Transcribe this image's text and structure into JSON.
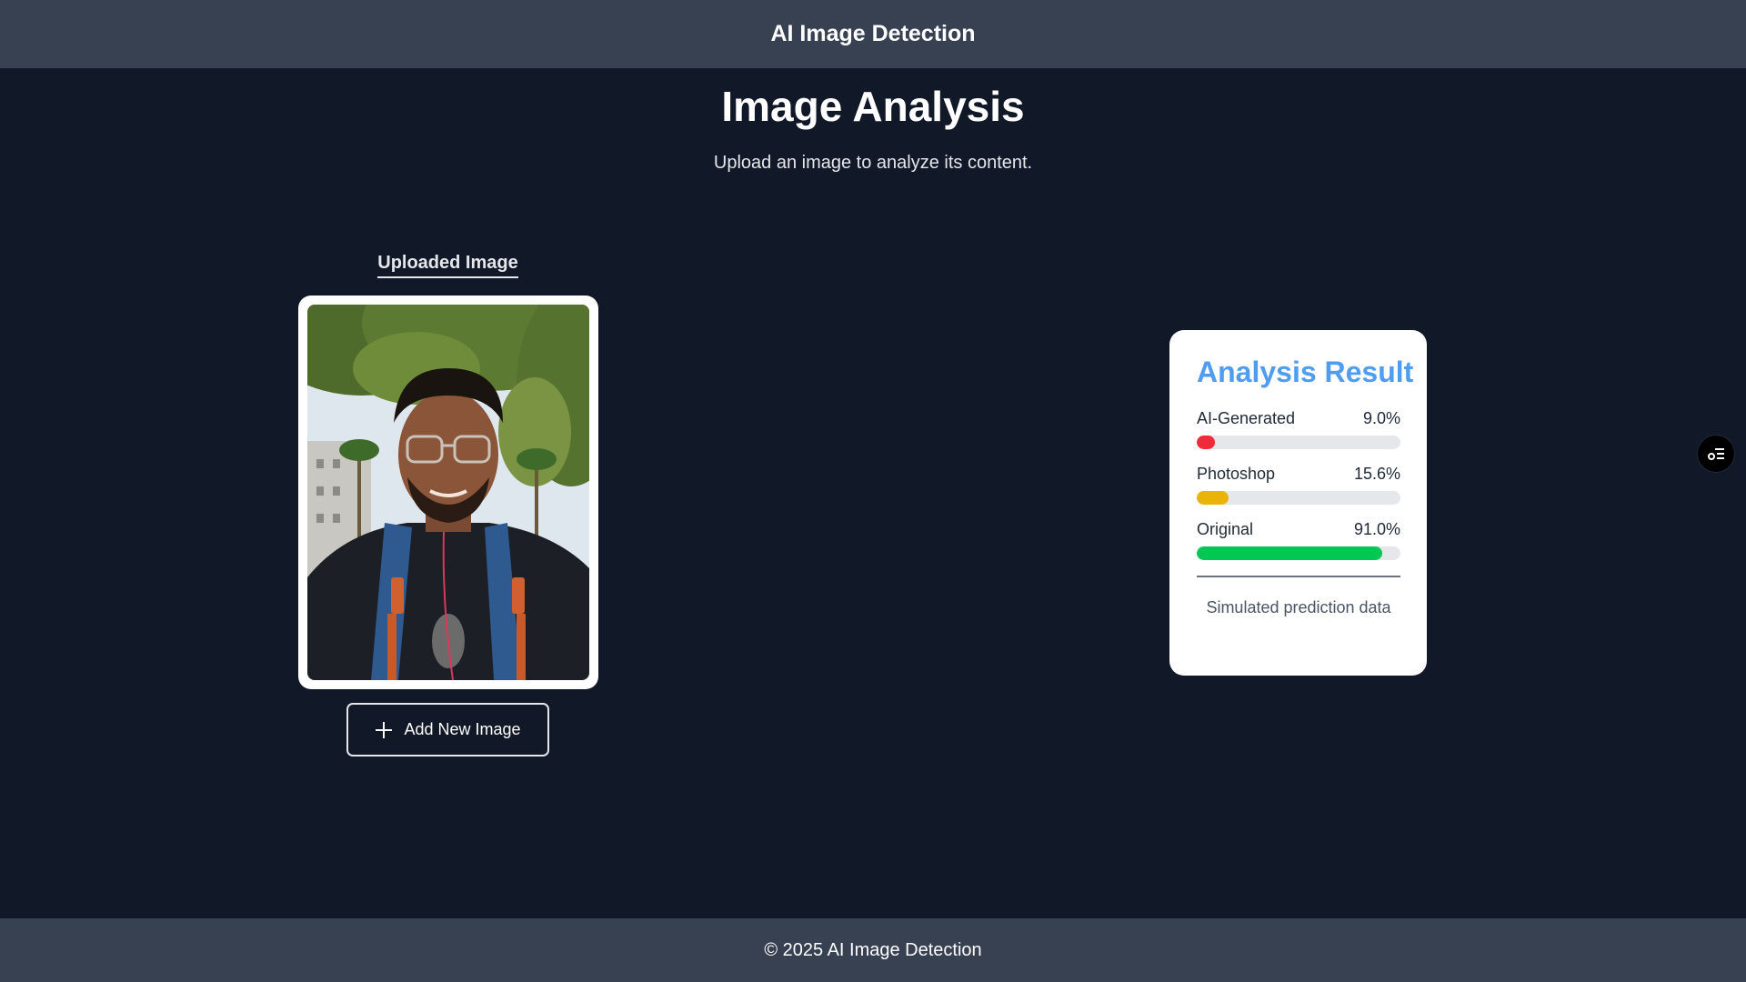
{
  "header": {
    "brand": "AI Image Detection"
  },
  "main": {
    "title": "Image Analysis",
    "subtitle": "Upload an image to analyze its content."
  },
  "upload": {
    "label": "Uploaded Image",
    "image_icon": "uploaded-photo",
    "add_button_label": "Add New Image",
    "add_icon": "plus-icon"
  },
  "result": {
    "title": "Analysis Result",
    "metrics": [
      {
        "label": "AI-Generated",
        "value_text": "9.0%",
        "value": 9.0,
        "color": "#ef2b3a"
      },
      {
        "label": "Photoshop",
        "value_text": "15.6%",
        "value": 15.6,
        "color": "#eab308"
      },
      {
        "label": "Original",
        "value_text": "91.0%",
        "value": 91.0,
        "color": "#00c853"
      }
    ],
    "footnote": "Simulated prediction data"
  },
  "floating": {
    "icon": "settings-list-icon"
  },
  "footer": {
    "copyright": "© 2025 AI Image Detection"
  },
  "colors": {
    "background": "#111827",
    "bar": "#374151",
    "accent": "#4f9cf0"
  }
}
